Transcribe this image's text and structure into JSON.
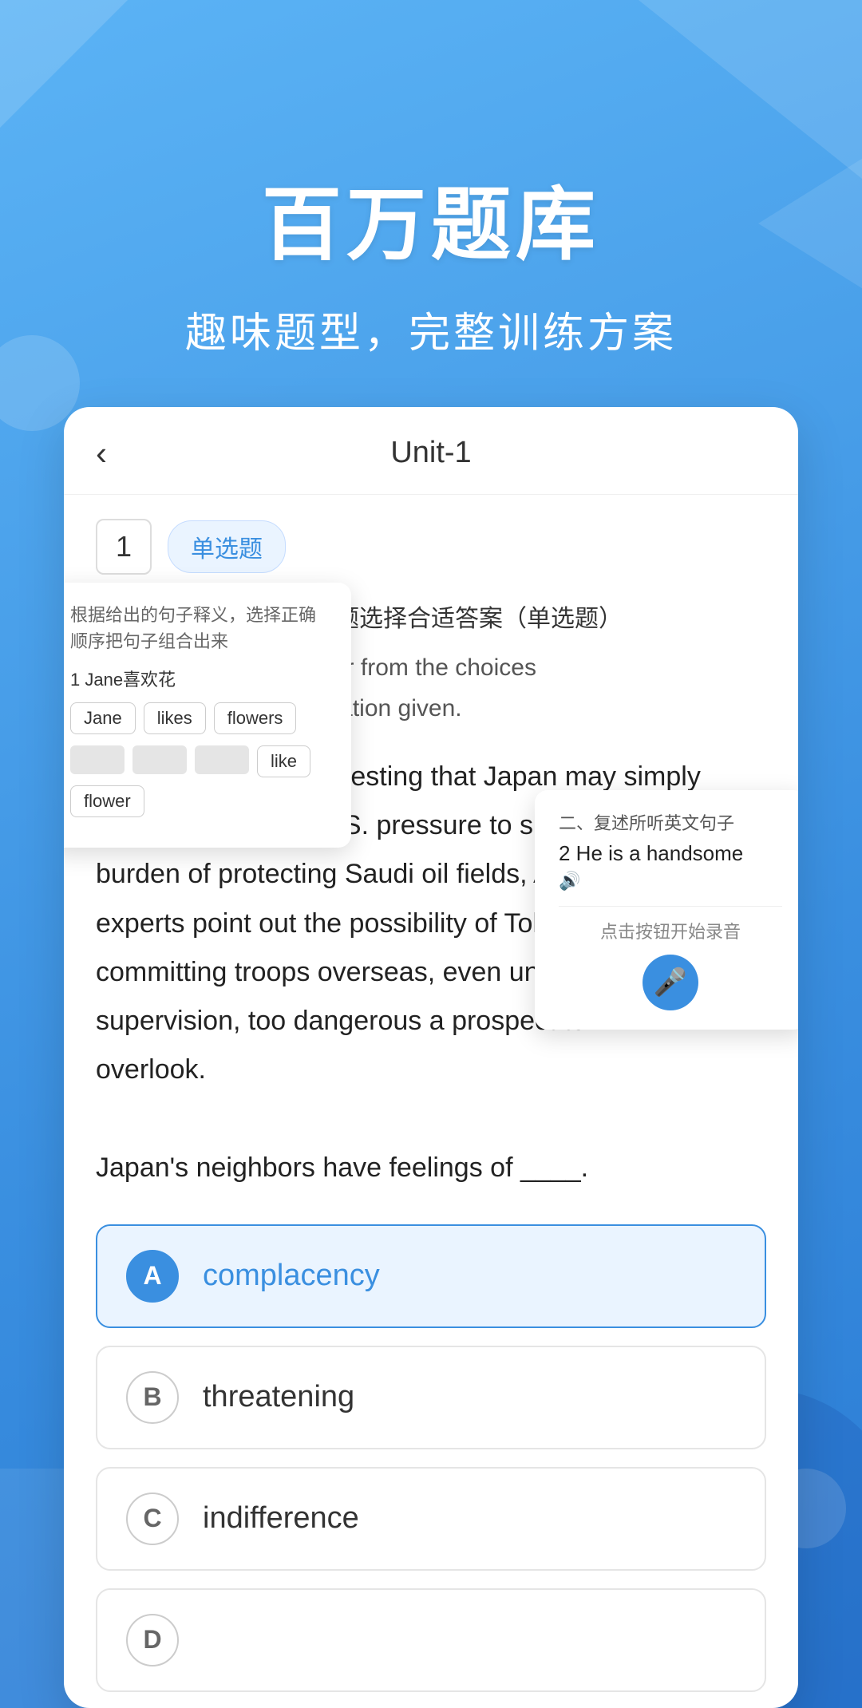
{
  "app": {
    "background_color": "#4A9EE8"
  },
  "hero": {
    "title": "百万题库",
    "subtitle": "趣味题型，完整训练方案"
  },
  "card": {
    "back_label": "‹",
    "title": "Unit-1",
    "question_number": "1",
    "question_type": "单选题",
    "instruction_zh": "根据题目，从给出的选项中选择合适答案（单选题）",
    "instruction_en": "Choose the best answer from the choices according to the information given.",
    "question_body": "There are signs suggesting that Japan may simply be succumbing to U.S. pressure to share the burden of protecting Saudi oil fields, Asian experts point out the possibility of Tokyo's committing troops overseas, even under U.S. supervision, too dangerous a prospect to overlook.\n\nJapan's neighbors have feelings of ____.",
    "options": [
      {
        "letter": "A",
        "text": "complacency",
        "selected": true
      },
      {
        "letter": "B",
        "text": "threatening",
        "selected": false
      },
      {
        "letter": "C",
        "text": "indifference",
        "selected": false
      },
      {
        "letter": "D",
        "text": "",
        "selected": false
      }
    ]
  },
  "popup_sentence": {
    "instruction": "根据给出的句子释义，选择正确顺序把句子组合出来",
    "sentence_label": "1 Jane喜欢花",
    "words": [
      "Jane",
      "likes",
      "flowers"
    ],
    "answer_words": [
      "like"
    ],
    "flower_chip": "flower"
  },
  "popup_audio": {
    "section_label": "二、复述所听英文句子",
    "sentence": "2 He is a handsome",
    "audio_icon": "🔊",
    "record_label": "点击按钮开始录音"
  }
}
